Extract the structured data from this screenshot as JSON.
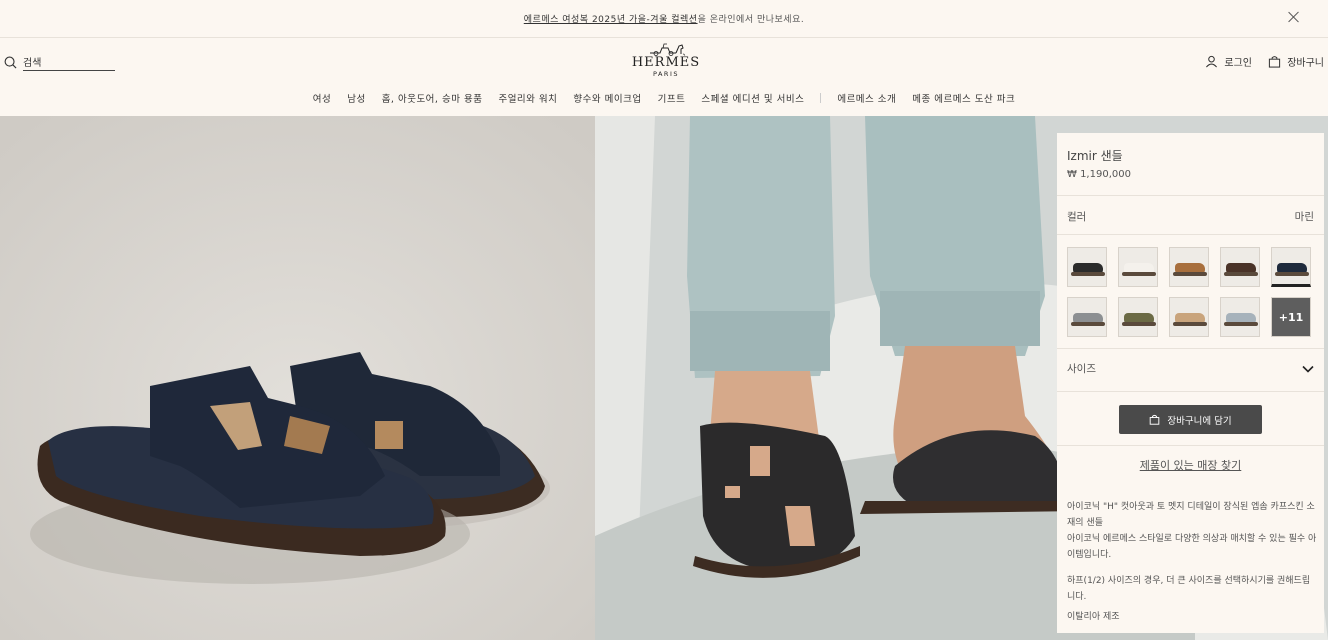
{
  "announcement": {
    "link_text": "에르메스 여성복 2025년 가을-겨울 컬렉션",
    "suffix": "을 온라인에서 만나보세요."
  },
  "header": {
    "search_label": "검색",
    "logo_name": "HERMÈS",
    "logo_city": "PARIS",
    "login_label": "로그인",
    "cart_label": "장바구니"
  },
  "nav": {
    "items": [
      "여성",
      "남성",
      "홈, 아웃도어, 승마 용품",
      "주얼리와 워치",
      "향수와 메이크업",
      "기프트",
      "스페셜 에디션 및 서비스"
    ],
    "secondary": [
      "에르메스 소개",
      "메종 에르메스 도산 파크"
    ]
  },
  "product": {
    "name": "Izmir 샌들",
    "price": "₩ 1,190,000",
    "color_label": "컬러",
    "color_value": "마린",
    "swatches": [
      {
        "color": "#2b2b2b"
      },
      {
        "color": "#f4f1ec"
      },
      {
        "color": "#a86f3d"
      },
      {
        "color": "#4a3328"
      },
      {
        "color": "#1e2a3c"
      },
      {
        "color": "#8c8f92"
      },
      {
        "color": "#6b6a45"
      },
      {
        "color": "#c9a47c"
      },
      {
        "color": "#a6b2bb"
      }
    ],
    "more_count": "+11",
    "size_label": "사이즈",
    "add_to_cart": "장바구니에 담기",
    "store_link": "제품이 있는 매장 찾기",
    "description_1": "아이코닉 \"H\" 컷아웃과 토 멧지 디테일이 장식된 엡솜 카프스킨 소재의 샌들",
    "description_2": "아이코닉 에르메스 스타일로 다양한 의상과 매치할 수 있는 필수 아이템입니다.",
    "description_3": "하프(1/2) 사이즈의 경우, 더 큰 사이즈를 선택하시기를 권해드립니다.",
    "origin": "이탈리아 제조"
  }
}
